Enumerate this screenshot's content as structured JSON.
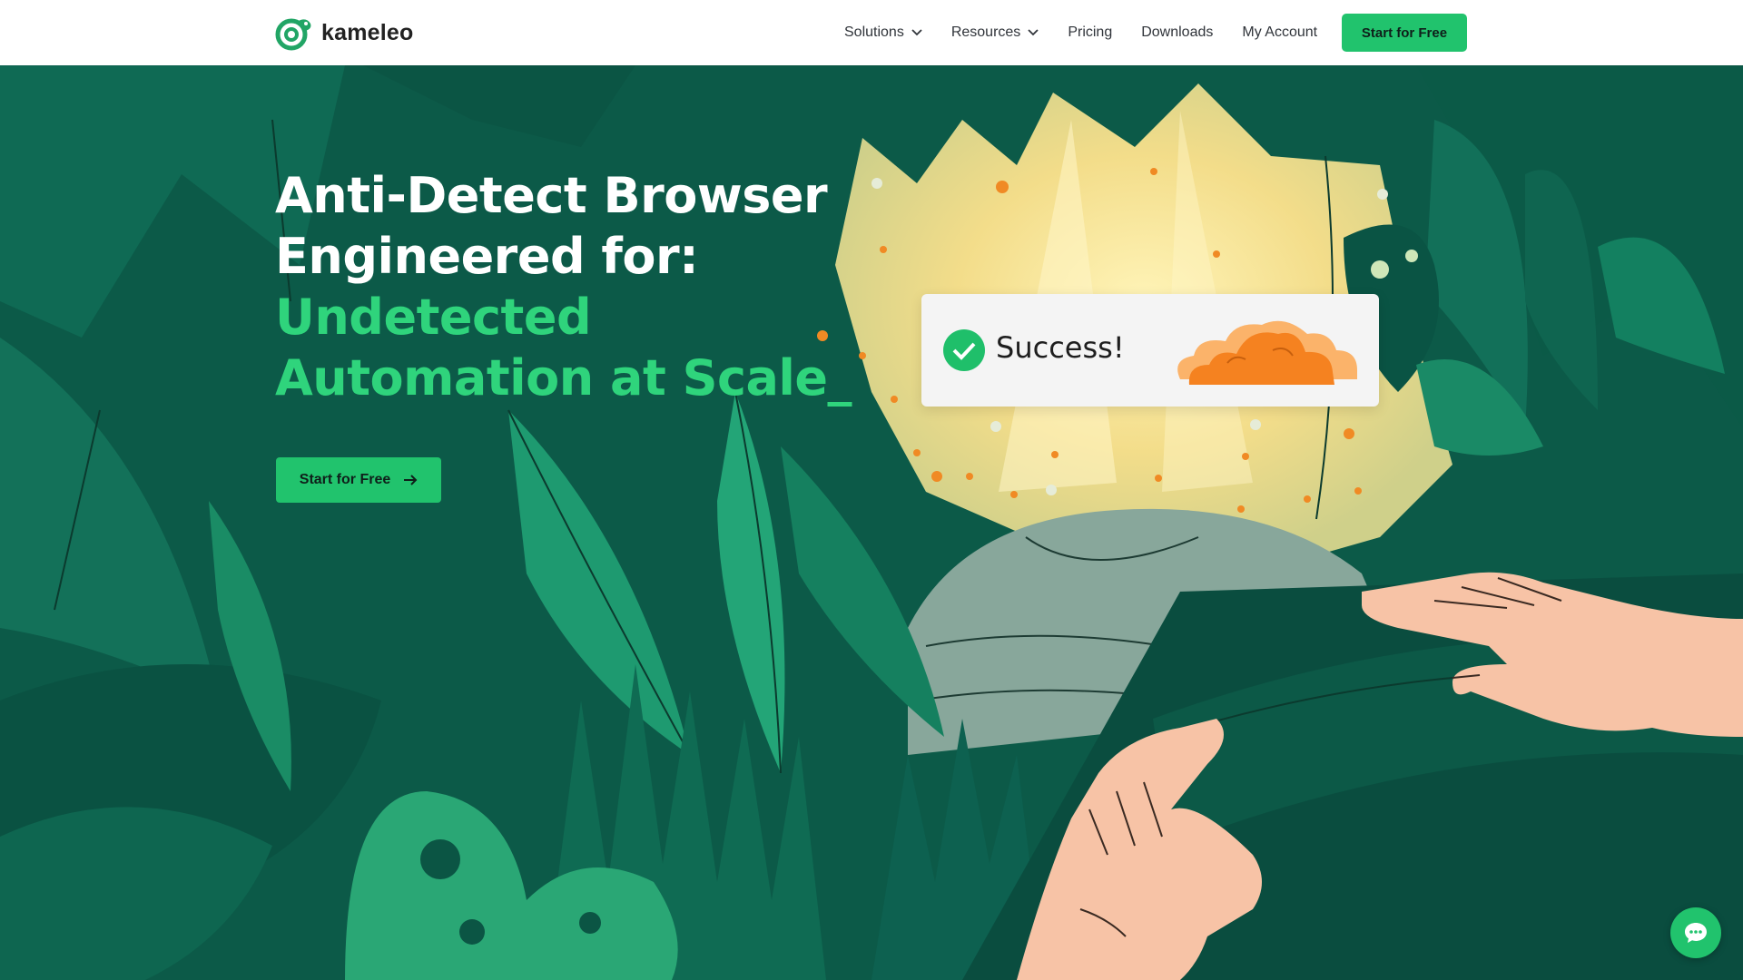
{
  "brand": {
    "name": "kameleo",
    "logo_icon": "chameleon-logo-icon"
  },
  "nav": {
    "items": [
      {
        "label": "Solutions",
        "has_dropdown": true
      },
      {
        "label": "Resources",
        "has_dropdown": true
      },
      {
        "label": "Pricing",
        "has_dropdown": false
      },
      {
        "label": "Downloads",
        "has_dropdown": false
      },
      {
        "label": "My Account",
        "has_dropdown": false
      }
    ],
    "cta_label": "Start for Free"
  },
  "hero": {
    "headline_line1": "Anti-Detect Browser",
    "headline_line2": "Engineered for:",
    "headline_highlight1": "Undetected",
    "headline_highlight2": "Automation at Scale_",
    "cta_label": "Start for Free",
    "cta_icon": "arrow-right-icon"
  },
  "success_card": {
    "text": "Success!",
    "check_icon": "check-circle-icon",
    "cloud_icon": "cloud-icon"
  },
  "chat_widget": {
    "icon": "chat-icon"
  },
  "colors": {
    "brand_green": "#21c36d",
    "highlight_green": "#2fd47c",
    "jungle_dark": "#0d5f4c",
    "cloud_orange": "#f58220",
    "skin": "#f7c3a6"
  }
}
